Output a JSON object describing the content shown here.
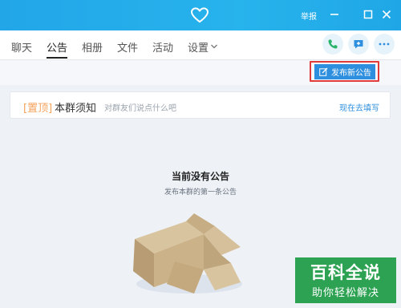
{
  "titlebar": {
    "report_label": "举报"
  },
  "tabs": [
    {
      "label": "聊天"
    },
    {
      "label": "公告"
    },
    {
      "label": "相册"
    },
    {
      "label": "文件"
    },
    {
      "label": "活动"
    },
    {
      "label": "设置"
    }
  ],
  "toolbar": {
    "publish_label": "发布新公告"
  },
  "notice_card": {
    "tag": "[置顶]",
    "title": "本群须知",
    "hint": "对群友们说点什么吧",
    "action": "现在去填写"
  },
  "empty_state": {
    "title": "当前没有公告",
    "subtitle": "发布本群的第一条公告"
  },
  "watermark": {
    "main": "百科全说",
    "sub": "助你轻松解决"
  },
  "colors": {
    "titlebar": "#27b3ec",
    "accent": "#2e8fde",
    "highlight_border": "#e03a3a",
    "tag": "#f4a15a"
  },
  "icons": [
    "heart-icon",
    "minimize-icon",
    "maximize-icon",
    "close-icon",
    "chevron-down-icon",
    "phone-icon",
    "chat-icon",
    "more-icon",
    "edit-icon"
  ]
}
